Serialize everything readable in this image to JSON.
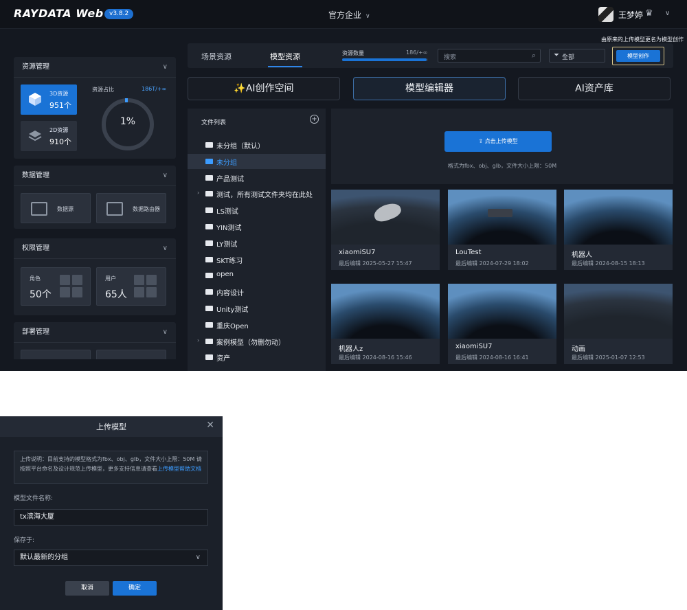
{
  "header": {
    "logo": "RAYDATA Web",
    "version": "v3.8.2",
    "company": "官方企业",
    "user": "王梦婷"
  },
  "sidebar": {
    "resource": {
      "title": "资源管理",
      "card3d_label": "3D资源",
      "card3d_count": "951个",
      "card2d_label": "2D资源",
      "card2d_count": "910个",
      "ratio_label": "资源占比",
      "ratio_value": "186T/+∞",
      "ring_percent": "1%"
    },
    "data": {
      "title": "数据管理",
      "source_label": "数据源",
      "router_label": "数据路由器"
    },
    "permission": {
      "title": "权限管理",
      "role_label": "角色",
      "role_count": "50个",
      "user_label": "用户",
      "user_count": "65人"
    },
    "deploy": {
      "title": "部署管理"
    }
  },
  "main": {
    "tabs": [
      {
        "label": "场景资源"
      },
      {
        "label": "模型资源"
      }
    ],
    "quota_label": "资源数量",
    "quota_value": "186/+∞",
    "quota_fraction": 0.98,
    "search_placeholder": "搜索",
    "filter_label": "全部",
    "create_button": "模型创作",
    "hint": "由原来的上传模型更名为模型创作",
    "big_buttons": [
      "✨AI创作空间",
      "模型编辑器",
      "AI资产库"
    ],
    "file_list_title": "文件列表",
    "folders": [
      {
        "name": "未分组（默认）",
        "expandable": false,
        "selected": false
      },
      {
        "name": "未分组",
        "expandable": false,
        "selected": true
      },
      {
        "name": "产品测试",
        "expandable": false,
        "selected": false
      },
      {
        "name": "测试，所有测试文件夹均在此处",
        "expandable": true,
        "selected": false
      },
      {
        "name": "LS测试",
        "expandable": false,
        "selected": false
      },
      {
        "name": "YIN测试",
        "expandable": false,
        "selected": false
      },
      {
        "name": "LY测试",
        "expandable": false,
        "selected": false
      },
      {
        "name": "SKT练习",
        "expandable": false,
        "selected": false
      },
      {
        "name": "open",
        "expandable": false,
        "selected": false
      },
      {
        "name": "内容设计",
        "expandable": false,
        "selected": false
      },
      {
        "name": "Unity测试",
        "expandable": false,
        "selected": false
      },
      {
        "name": "重庆Open",
        "expandable": false,
        "selected": false
      },
      {
        "name": "案例模型（勿删勿动）",
        "expandable": true,
        "selected": false
      },
      {
        "name": "资产",
        "expandable": false,
        "selected": false
      }
    ],
    "upload_button": "⇪ 点击上传模型",
    "upload_note": "格式为fbx、obj、glb，文件大小上限：50M",
    "models": [
      {
        "name": "xiaomiSU7",
        "edited": "最后编辑 2025-05-27 15:47"
      },
      {
        "name": "LouTest",
        "edited": "最后编辑 2024-07-29 18:02"
      },
      {
        "name": "机器人",
        "edited": "最后编辑 2024-08-15 18:13"
      },
      {
        "name": "机器人z",
        "edited": "最后编辑 2024-08-16 15:46"
      },
      {
        "name": "xiaomiSU7",
        "edited": "最后编辑 2024-08-16 16:41"
      },
      {
        "name": "动画",
        "edited": "最后编辑 2025-01-07 12:53"
      }
    ]
  },
  "dialog": {
    "title": "上传模型",
    "notice": "上传说明：目前支持的模型格式为fbx、obj、glb，文件大小上限：50M 请按照平台命名及设计规范上传模型，更多支持信息请查看",
    "notice_link": "上传模型帮助文档",
    "name_label": "模型文件名称:",
    "name_value": "tx滨海大厦",
    "save_label": "保存于:",
    "save_value": "默认最新的分组",
    "cancel": "取消",
    "confirm": "确定"
  }
}
